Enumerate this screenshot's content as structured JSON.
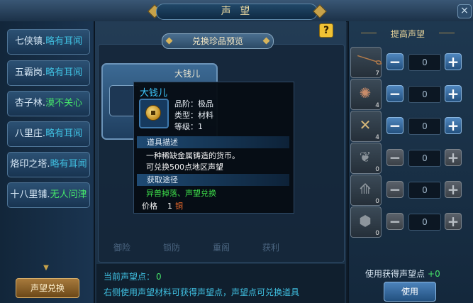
{
  "window": {
    "title": "声 望",
    "close_label": "×"
  },
  "sidebar": {
    "items": [
      {
        "name": "七侠镇.",
        "status": "略有耳闻",
        "tone": "cold"
      },
      {
        "name": "五霸岗.",
        "status": "略有耳闻",
        "tone": "cold"
      },
      {
        "name": "杏子林.",
        "status": "漠不关心",
        "tone": "none"
      },
      {
        "name": "八里庄.",
        "status": "略有耳闻",
        "tone": "cold"
      },
      {
        "name": "烙印之塔.",
        "status": "略有耳闻",
        "tone": "cold"
      },
      {
        "name": "十八里铺.",
        "status": "无人问津",
        "tone": "none"
      }
    ],
    "exchange_button": "声望兑换"
  },
  "main": {
    "help_label": "?",
    "preview_tab": "兑换珍品预览",
    "card_name": "大钱儿",
    "ghost_row": [
      "御险",
      "锁防",
      "重阁",
      "获利"
    ]
  },
  "tooltip": {
    "title": "大钱儿",
    "grade_label": "品阶：极品",
    "type_label": "类型：材料",
    "level_label": "等级：1",
    "desc_header": "道具描述",
    "desc_line1": "一种稀缺金属铸造的货币。",
    "desc_line2": "可兑换500点地区声望",
    "source_header": "获取途径",
    "source_text": "异兽掉落、声望兑换",
    "price_label": "价格",
    "price_value": "1",
    "price_unit": "铜"
  },
  "right_panel": {
    "title": "提高声望",
    "rows": [
      {
        "icon": "claw-icon",
        "glyph": "𐃆",
        "count": "7",
        "qty": "0",
        "enabled": true
      },
      {
        "icon": "feather-icon",
        "glyph": "✺",
        "count": "4",
        "qty": "0",
        "enabled": true
      },
      {
        "icon": "scroll-icon",
        "glyph": "✕",
        "count": "4",
        "qty": "0",
        "enabled": true
      },
      {
        "icon": "wing-icon",
        "glyph": "❦",
        "count": "0",
        "qty": "0",
        "enabled": false
      },
      {
        "icon": "shard-icon",
        "glyph": "⟰",
        "count": "0",
        "qty": "0",
        "enabled": false
      },
      {
        "icon": "stone-icon",
        "glyph": "⬢",
        "count": "0",
        "qty": "0",
        "enabled": false
      }
    ],
    "minus_label": "−",
    "plus_label": "+"
  },
  "bottom": {
    "current_points_label": "当前声望点：",
    "current_points_value": "0",
    "hint": "右侧使用声望材料可获得声望点，声望点可兑换道具",
    "gain_label": "使用获得声望点",
    "gain_value": "+0",
    "use_button": "使用"
  },
  "colors": {
    "cold": "#3fbfe0",
    "none": "#45e36a",
    "price_unit": "#f06a2a"
  }
}
